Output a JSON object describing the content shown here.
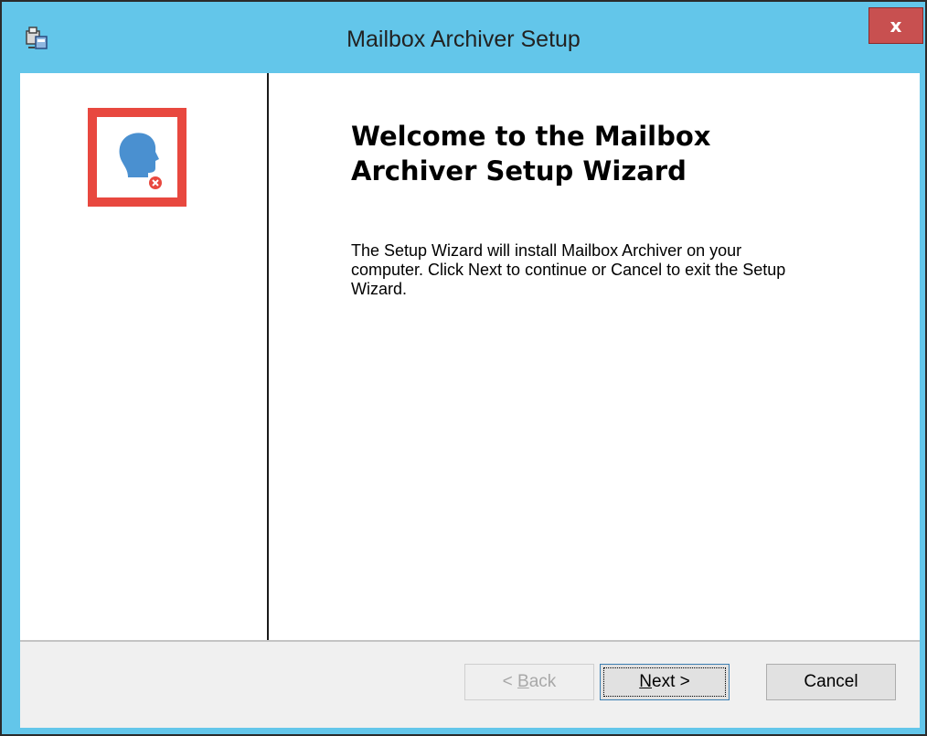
{
  "window": {
    "title": "Mailbox Archiver Setup",
    "close_label": "x"
  },
  "welcome": {
    "heading_line1": "Welcome to the Mailbox",
    "heading_line2": "Archiver Setup Wizard",
    "body_line1": "The Setup Wizard will install Mailbox Archiver on your",
    "body_line2": "computer. Click Next to continue or Cancel to exit the Setup",
    "body_line3": "Wizard."
  },
  "buttons": {
    "back": {
      "prefix": "< ",
      "mnemonic": "B",
      "rest": "ack",
      "enabled": false
    },
    "next": {
      "mnemonic": "N",
      "rest": "ext >",
      "focused": true
    },
    "cancel": "Cancel"
  },
  "colors": {
    "title_bar": "#63c6ea",
    "close_button": "#c85050",
    "logo_frame": "#e8483f",
    "logo_head": "#4a90d0"
  },
  "icons": {
    "app": "installer-package-icon",
    "logo": "user-head-remove-icon"
  }
}
